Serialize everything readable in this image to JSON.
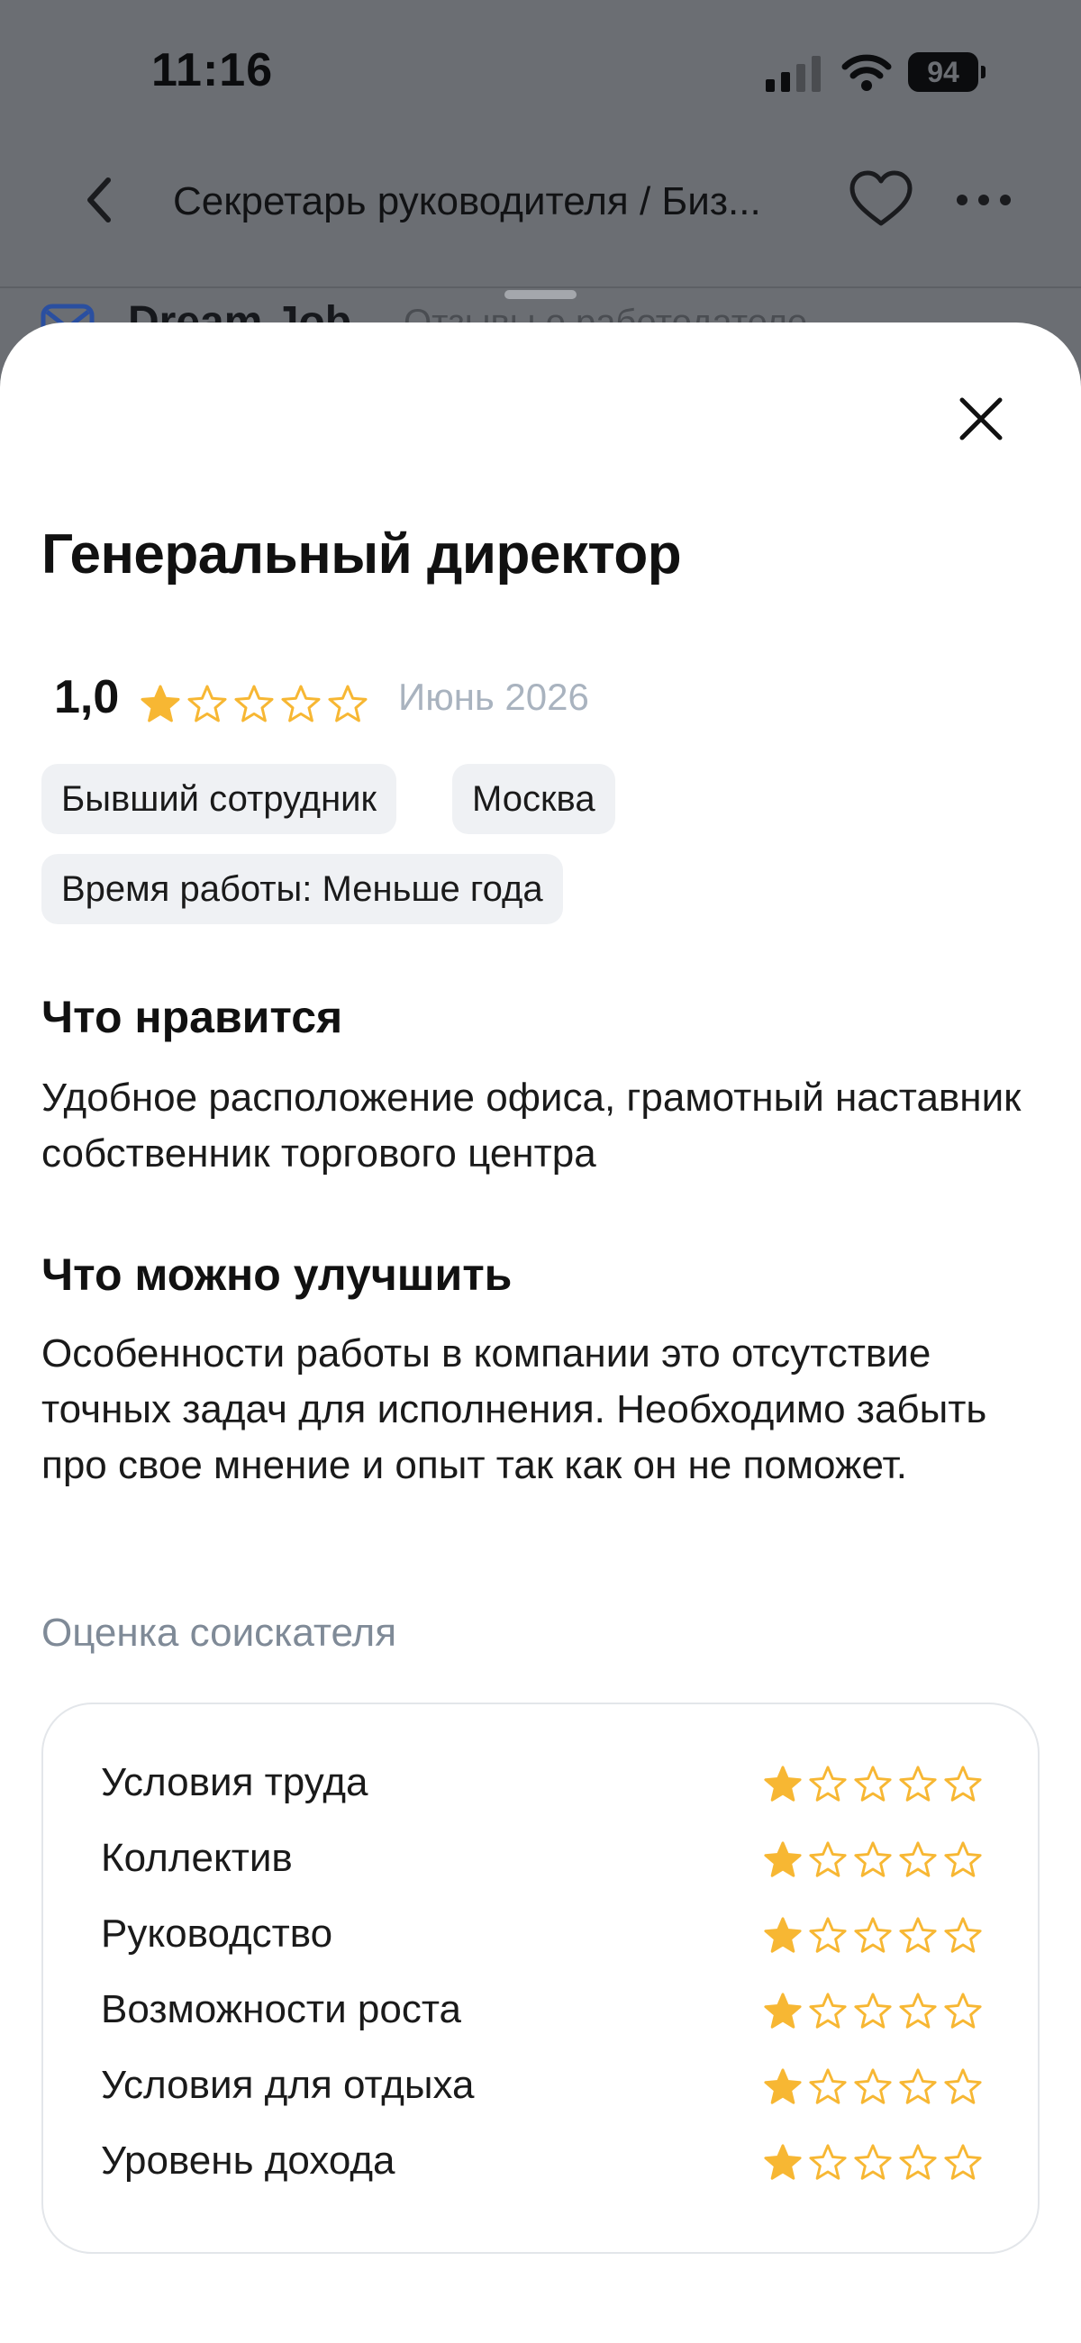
{
  "status_bar": {
    "time": "11:16",
    "battery": "94"
  },
  "nav": {
    "title": "Секретарь руководителя / Биз...",
    "icons": [
      "chevron-left-icon",
      "heart-icon",
      "more-icon"
    ]
  },
  "peek": {
    "company": "Dream Job",
    "subtitle": "Отзывы о работодателе"
  },
  "sheet": {
    "title": "Генеральный директор",
    "rating": {
      "value": "1,0",
      "stars": 1,
      "max_stars": 5,
      "date": "Июнь 2026"
    },
    "chips": [
      "Бывший сотрудник",
      "Москва",
      "Время работы: Меньше года"
    ],
    "likes": {
      "heading": "Что нравится",
      "text": "Удобное расположение офиса, грамотный наставник собственник торгового центра"
    },
    "improve": {
      "heading": "Что можно улучшить",
      "text": "Особенности работы в компании это отсутствие точных задач для исполнения. Необходимо забыть про свое мнение и опыт так как он не поможет."
    },
    "assessment_label": "Оценка соискателя",
    "criteria": [
      {
        "label": "Условия труда",
        "stars": 1
      },
      {
        "label": "Коллектив",
        "stars": 1
      },
      {
        "label": "Руководство",
        "stars": 1
      },
      {
        "label": "Возможности роста",
        "stars": 1
      },
      {
        "label": "Условия для отдыха",
        "stars": 1
      },
      {
        "label": "Уровень дохода",
        "stars": 1
      }
    ]
  },
  "colors": {
    "star": "#f7b733",
    "overlay": "#6b6e73",
    "muted": "#a9b3bf"
  }
}
